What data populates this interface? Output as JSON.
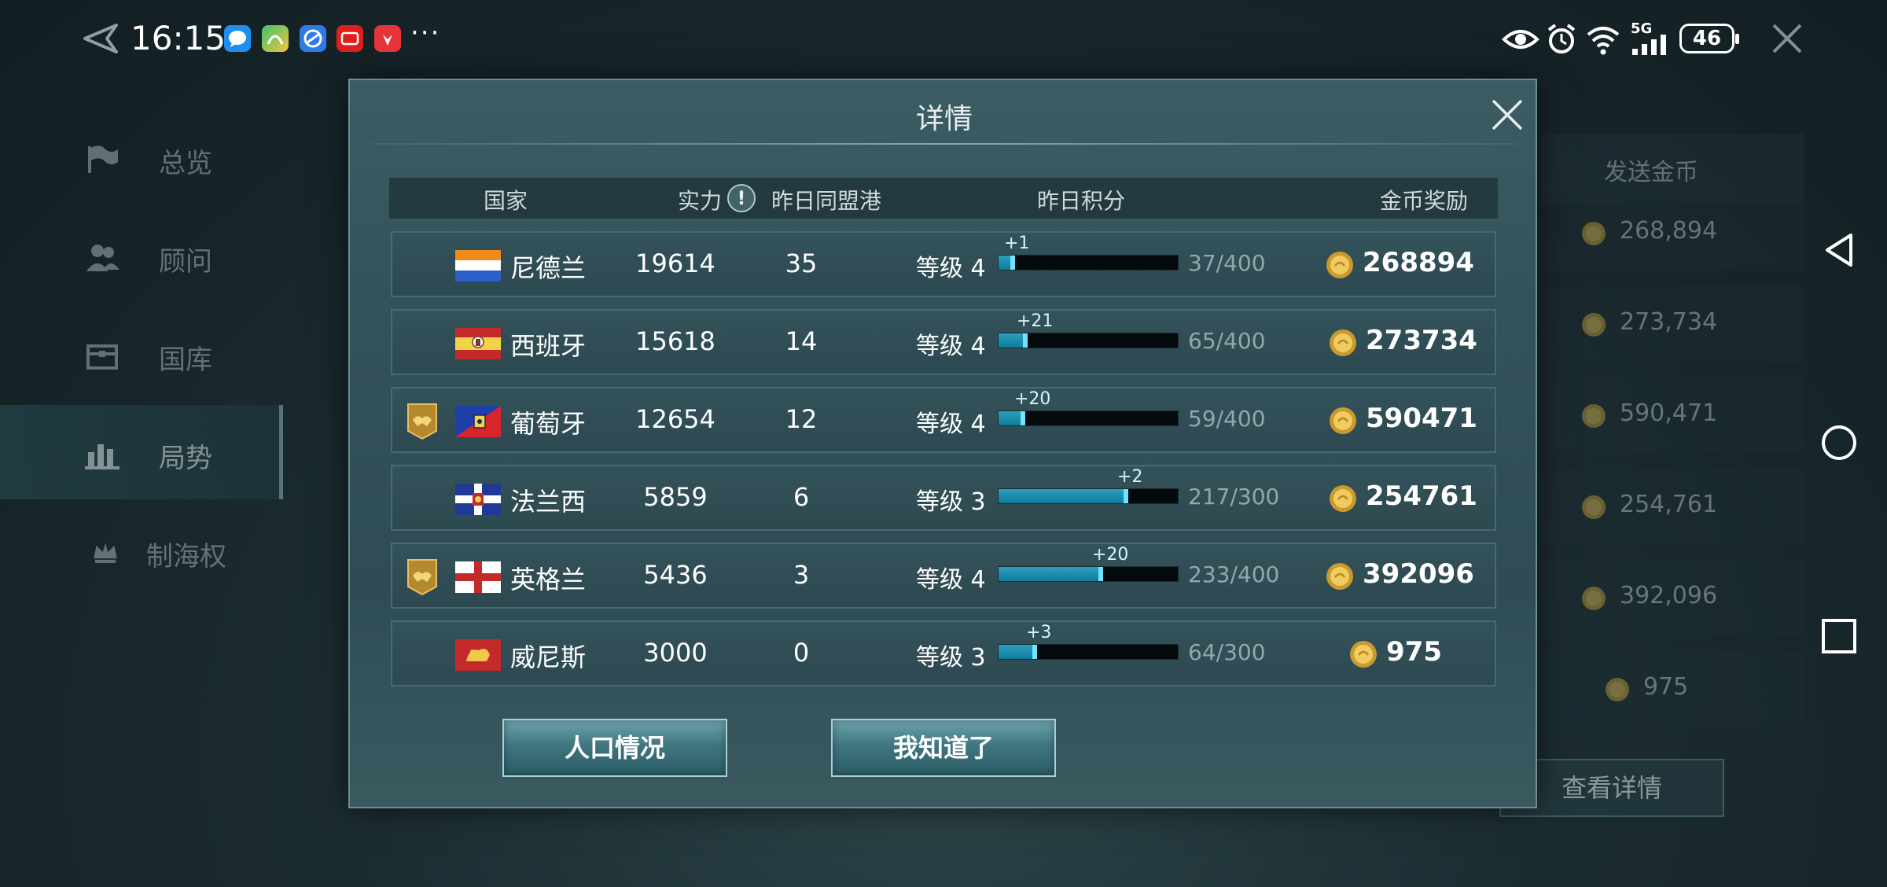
{
  "status_bar": {
    "time": "16:15",
    "more": "···",
    "network": "5G",
    "battery": "46",
    "apps": [
      "message-app-icon",
      "assistant-app-icon",
      "browser-app-icon",
      "tmall-app-icon",
      "huawei-app-icon"
    ]
  },
  "background_menu": {
    "items": [
      {
        "label": "总览",
        "icon": "flag-icon"
      },
      {
        "label": "顾问",
        "icon": "people-icon"
      },
      {
        "label": "国库",
        "icon": "treasury-icon"
      },
      {
        "label": "局势",
        "icon": "bar-chart-icon",
        "active": true
      },
      {
        "label": "制海权",
        "icon": "crown-icon"
      }
    ]
  },
  "background_panel": {
    "header": "发送金币",
    "values": [
      "268,894",
      "273,734",
      "590,471",
      "254,761",
      "392,096",
      "975"
    ],
    "detail_button": "查看详情"
  },
  "dialog": {
    "title": "详情",
    "columns": {
      "country": "国家",
      "power": "实力",
      "power_info": "!",
      "ports": "昨日同盟港",
      "points": "昨日积分",
      "reward": "金币奖励"
    },
    "rows": [
      {
        "country": "尼德兰",
        "flag": "netherlands-flag",
        "alliance": false,
        "power": "19614",
        "ports": "35",
        "level": "等级 4",
        "gain": "+1",
        "score": "37/400",
        "progress": 0.0925,
        "reward": "268894"
      },
      {
        "country": "西班牙",
        "flag": "spain-flag",
        "alliance": false,
        "power": "15618",
        "ports": "14",
        "level": "等级 4",
        "gain": "+21",
        "score": "65/400",
        "progress": 0.1625,
        "reward": "273734"
      },
      {
        "country": "葡萄牙",
        "flag": "portugal-flag",
        "alliance": true,
        "power": "12654",
        "ports": "12",
        "level": "等级 4",
        "gain": "+20",
        "score": "59/400",
        "progress": 0.1475,
        "reward": "590471"
      },
      {
        "country": "法兰西",
        "flag": "france-flag",
        "alliance": false,
        "power": "5859",
        "ports": "6",
        "level": "等级 3",
        "gain": "+2",
        "score": "217/300",
        "progress": 0.7233,
        "reward": "254761"
      },
      {
        "country": "英格兰",
        "flag": "england-flag",
        "alliance": true,
        "power": "5436",
        "ports": "3",
        "level": "等级 4",
        "gain": "+20",
        "score": "233/400",
        "progress": 0.5825,
        "reward": "392096"
      },
      {
        "country": "威尼斯",
        "flag": "venice-flag",
        "alliance": false,
        "power": "3000",
        "ports": "0",
        "level": "等级 3",
        "gain": "+3",
        "score": "64/300",
        "progress": 0.2133,
        "reward": "975"
      }
    ],
    "buttons": {
      "population": "人口情况",
      "ok": "我知道了"
    }
  },
  "colors": {
    "accent": "#2aa0c0",
    "dialog_bg": "#34525a",
    "gold": "#e0b040"
  }
}
